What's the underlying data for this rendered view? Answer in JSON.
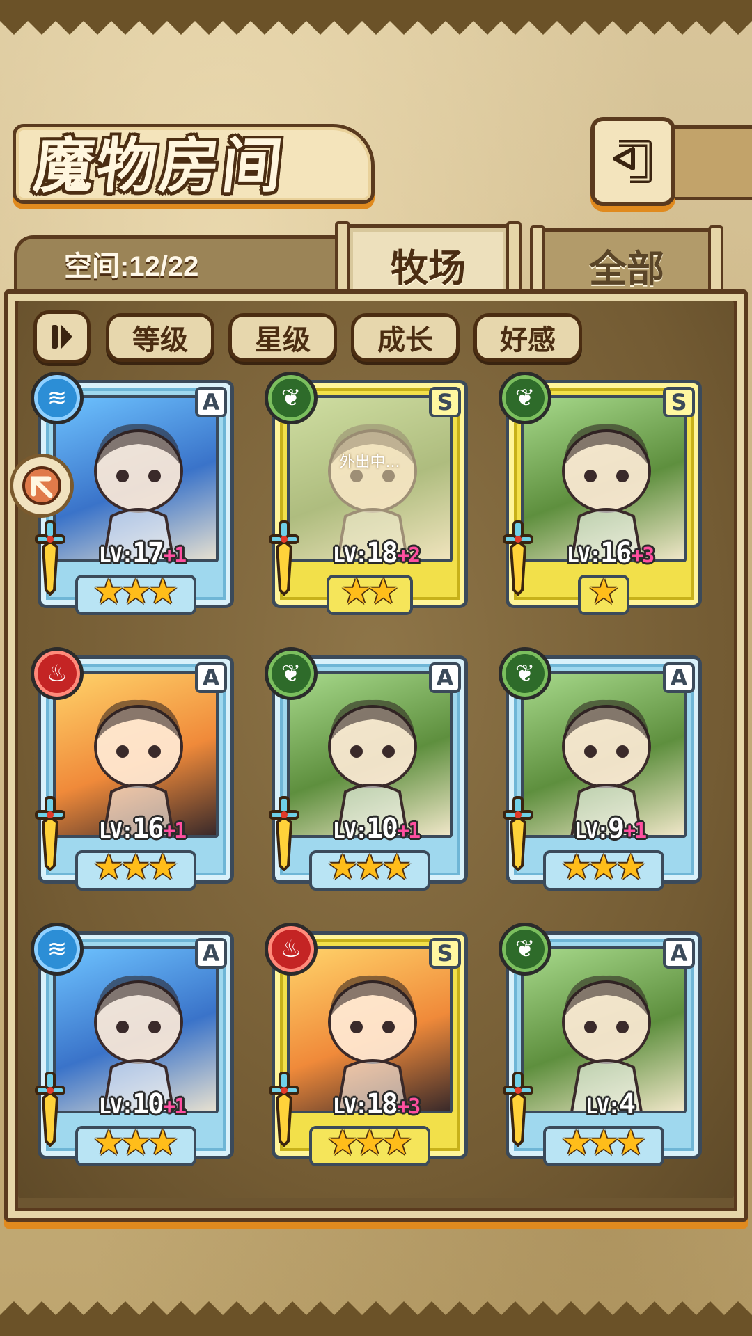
{
  "header": {
    "title": "魔物房间",
    "back_icon": "return-arrow-icon"
  },
  "tabs": {
    "space_label": "空间:12/22",
    "active": "牧场",
    "other": "全部"
  },
  "sort": {
    "toggle_icon": "pause-sort-icon",
    "buttons": [
      "等级",
      "星级",
      "成长",
      "好感"
    ]
  },
  "cards": [
    {
      "rank": "A",
      "element": "water",
      "level": "17",
      "bonus": "+1",
      "stars": 3,
      "away": ""
    },
    {
      "rank": "S",
      "element": "nature",
      "level": "18",
      "bonus": "+2",
      "stars": 2,
      "away": "外出中..."
    },
    {
      "rank": "S",
      "element": "nature",
      "level": "16",
      "bonus": "+3",
      "stars": 1,
      "away": ""
    },
    {
      "rank": "A",
      "element": "fire",
      "level": "16",
      "bonus": "+1",
      "stars": 3,
      "away": ""
    },
    {
      "rank": "A",
      "element": "nature",
      "level": "10",
      "bonus": "+1",
      "stars": 3,
      "away": ""
    },
    {
      "rank": "A",
      "element": "nature",
      "level": "9",
      "bonus": "+1",
      "stars": 3,
      "away": ""
    },
    {
      "rank": "A",
      "element": "water",
      "level": "10",
      "bonus": "+1",
      "stars": 3,
      "away": ""
    },
    {
      "rank": "S",
      "element": "fire",
      "level": "18",
      "bonus": "+3",
      "stars": 3,
      "away": ""
    },
    {
      "rank": "A",
      "element": "nature",
      "level": "4",
      "bonus": "",
      "stars": 3,
      "away": ""
    }
  ],
  "lv_prefix": "LV:",
  "colors": {
    "accent_orange": "#e08a1e",
    "frame_brown": "#5a3a1e",
    "rank_a_frame": "#9fd8ee",
    "rank_s_frame": "#f2e04a",
    "bonus_pink": "#ff4fa0"
  }
}
